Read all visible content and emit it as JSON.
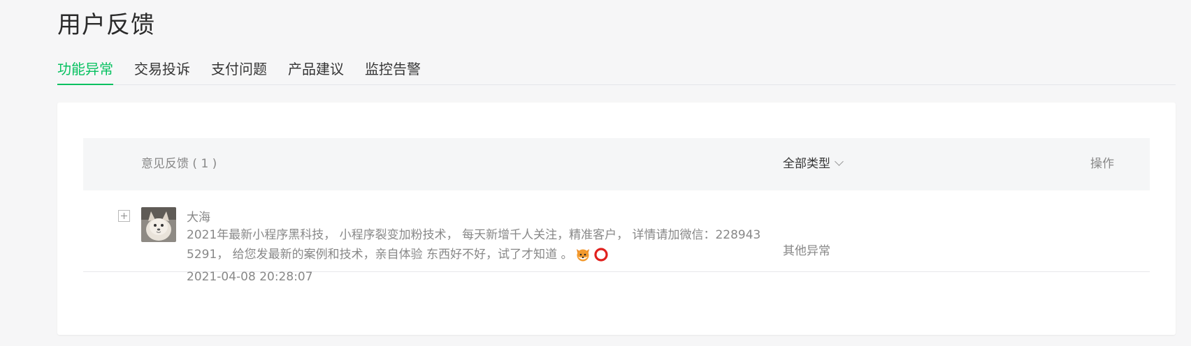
{
  "page": {
    "title": "用户反馈"
  },
  "tabs": [
    {
      "label": "功能异常",
      "active": true
    },
    {
      "label": "交易投诉",
      "active": false
    },
    {
      "label": "支付问题",
      "active": false
    },
    {
      "label": "产品建议",
      "active": false
    },
    {
      "label": "监控告警",
      "active": false
    }
  ],
  "table": {
    "header": {
      "feedback": "意见反馈 ( 1 )",
      "type_filter": "全部类型",
      "operation": "操作"
    },
    "rows": [
      {
        "user": "大海",
        "content": "2021年最新小程序黑科技， 小程序裂变加粉技术， 每天新增千人关注，精准客户， 详情请加微信：2289435291， 给您发最新的案例和技术，亲自体验 东西好不好，试了才知道 。",
        "emojis": [
          "fox-face-icon",
          "red-circle-icon"
        ],
        "time": "2021-04-08 20:28:07",
        "type": "其他异常"
      }
    ]
  },
  "colors": {
    "accent": "#07c160",
    "background": "#f6f6f7",
    "muted_text": "#888888"
  }
}
